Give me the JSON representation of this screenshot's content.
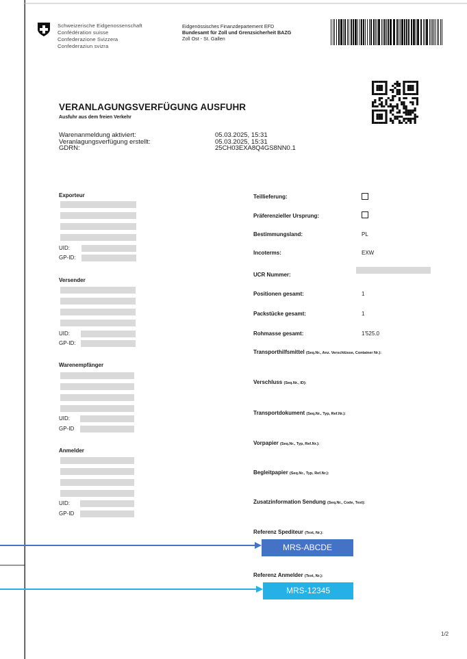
{
  "header": {
    "federation_lines": [
      "Schweizerische Eidgenossenschaft",
      "Confédération suisse",
      "Confederazione Svizzera",
      "Confederaziun svizra"
    ],
    "department": "Eidgenössisches Finanzdepartement EFD",
    "office": "Bundesamt für Zoll und Grenzsicherheit BAZG",
    "location": "Zoll Ost - St. Gallen"
  },
  "document": {
    "title": "VERANLAGUNGSVERFÜGUNG AUSFUHR",
    "subtitle": "Ausfuhr aus dem freien Verkehr",
    "meta_labels": [
      "Warenanmeldung aktiviert:",
      "Veranlagungsverfügung erstellt:",
      "GDRN:"
    ],
    "meta_values": [
      "05.03.2025, 15:31",
      "05.03.2025, 15:31",
      "25CH03EXA8Q4GS8NN0.1"
    ]
  },
  "left_sections": {
    "exporteur": "Exporteur",
    "versender": "Versender",
    "warenempfaenger": "Warenempfänger",
    "anmelder": "Anmelder",
    "uid_label": "UID:",
    "gpid_label": "GP-ID:",
    "gpid_label_short": "GP-ID"
  },
  "right_fields": {
    "teillieferung": "Teillieferung:",
    "praeferenz": "Präferenzieller Ursprung:",
    "bestimmungsland": "Bestimmungsland:",
    "bestimmungsland_value": "PL",
    "incoterms": "Incoterms:",
    "incoterms_value": "EXW",
    "ucr": "UCR Nummer:",
    "positionen": "Positionen gesamt:",
    "positionen_value": "1",
    "packstuecke": "Packstücke gesamt:",
    "packstuecke_value": "1",
    "rohmasse": "Rohmasse gesamt:",
    "rohmasse_value": "1'525.0",
    "transporthilfsmittel": "Transporthilfsmittel",
    "transporthilfsmittel_note": "(Seq.Nr., Anz. Verschlüsse, Container Nr.):",
    "verschluss": "Verschluss",
    "verschluss_note": "(Seq.Nr., ID):",
    "transportdokument": "Transportdokument",
    "transportdokument_note": "(Seq.Nr., Typ, Ref.Nr.):",
    "vorpapier": "Vorpapier",
    "vorpapier_note": "(Seq.Nr., Typ, Ref.Nr.):",
    "begleitpapier": "Begleitpapier",
    "begleitpapier_note": "(Seq.Nr., Typ, Ref.Nr.):",
    "zusatzinformation": "Zusatzinformation Sendung",
    "zusatzinformation_note": "(Seq.Nr., Code, Text):",
    "ref_spediteur": "Referenz Spediteur",
    "ref_spediteur_note": "(Text, Nr.):",
    "ref_spediteur_value": "MRS-ABCDE",
    "ref_anmelder": "Referenz Anmelder",
    "ref_anmelder_note": "(Text, Nr.):",
    "ref_anmelder_value": "MRS-12345"
  },
  "footer": {
    "page_number": "1/2"
  },
  "colors": {
    "badge_blue": "#4472c4",
    "badge_cyan": "#25b0e6",
    "redaction": "#d9d9d9"
  }
}
